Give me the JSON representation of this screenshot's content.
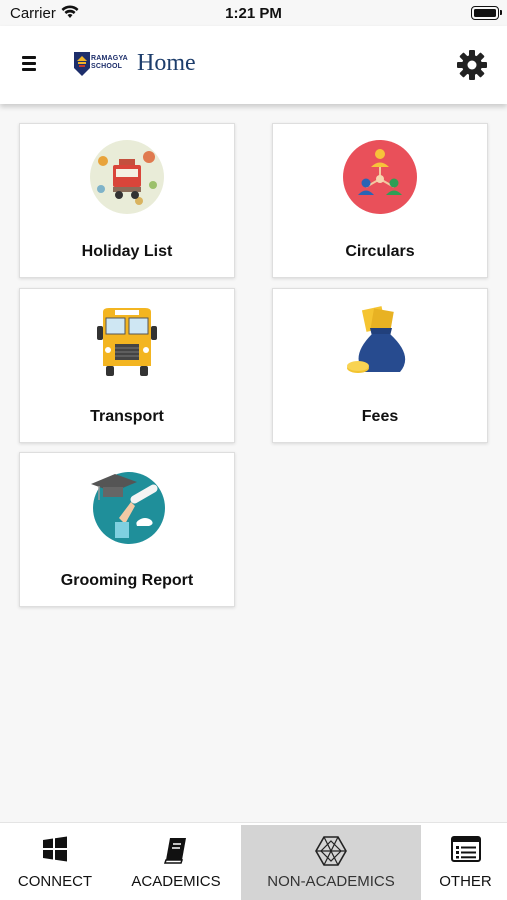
{
  "status_bar": {
    "carrier": "Carrier",
    "time": "1:21 PM"
  },
  "header": {
    "title": "Home",
    "logo_text_line1": "RAMAGYA",
    "logo_text_line2": "SCHOOL",
    "menu_icon": "hamburger-menu-icon",
    "settings_icon": "gear-icon"
  },
  "cards": [
    {
      "label": "Holiday List",
      "icon": "holiday-truck-icon"
    },
    {
      "label": "Circulars",
      "icon": "network-people-icon"
    },
    {
      "label": "Transport",
      "icon": "school-bus-icon"
    },
    {
      "label": "Fees",
      "icon": "money-bag-icon"
    },
    {
      "label": "Grooming Report",
      "icon": "graduation-cap-icon"
    }
  ],
  "tabs": [
    {
      "label": "CONNECT",
      "icon": "windows-icon",
      "selected": false
    },
    {
      "label": "ACADEMICS",
      "icon": "book-icon",
      "selected": false
    },
    {
      "label": "NON-ACADEMICS",
      "icon": "hexagon-icon",
      "selected": true
    },
    {
      "label": "OTHER",
      "icon": "list-window-icon",
      "selected": false
    }
  ],
  "colors": {
    "brand_navy": "#1d3d6b",
    "selected_tab_bg": "#d4d4d4",
    "circulars_red": "#e9505a",
    "grooming_teal": "#1f8f9a"
  }
}
